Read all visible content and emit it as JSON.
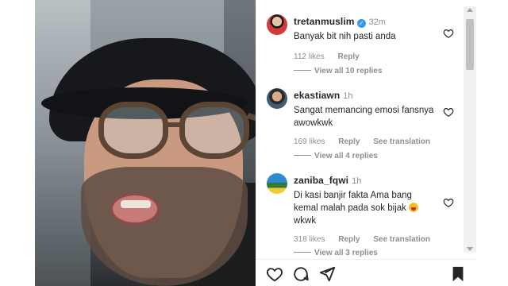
{
  "comments": [
    {
      "username": "tretanmuslim",
      "verified": true,
      "time": "32m",
      "text": "Banyak bit nih pasti anda",
      "likes": "112 likes",
      "reply": "Reply",
      "view_replies": "View all 10 replies",
      "avatar_icon": "user-avatar-icon"
    },
    {
      "username": "ekastiawn",
      "verified": false,
      "time": "1h",
      "text_line1": "Sangat memancing emosi fansnya",
      "text_line2": "awowkwk",
      "likes": "169 likes",
      "reply": "Reply",
      "see_translation": "See translation",
      "view_replies": "View all 4 replies",
      "avatar_icon": "user-avatar-icon"
    },
    {
      "username": "zaniba_fqwi",
      "verified": false,
      "time": "1h",
      "text_line1": "Di kasi banjir fakta Ama bang",
      "text_line2": "kemal malah pada sok bijak",
      "text_line3": "wkwk",
      "likes": "318 likes",
      "reply": "Reply",
      "see_translation": "See translation",
      "view_replies": "View all 3 replies",
      "avatar_icon": "user-avatar-icon"
    }
  ],
  "actions": {
    "like_icon": "heart-icon",
    "comment_icon": "comment-icon",
    "share_icon": "send-icon",
    "save_icon": "bookmark-icon"
  },
  "colors": {
    "text": "#262626",
    "secondary_text": "#8e8e8e",
    "verified": "#3897f0"
  }
}
